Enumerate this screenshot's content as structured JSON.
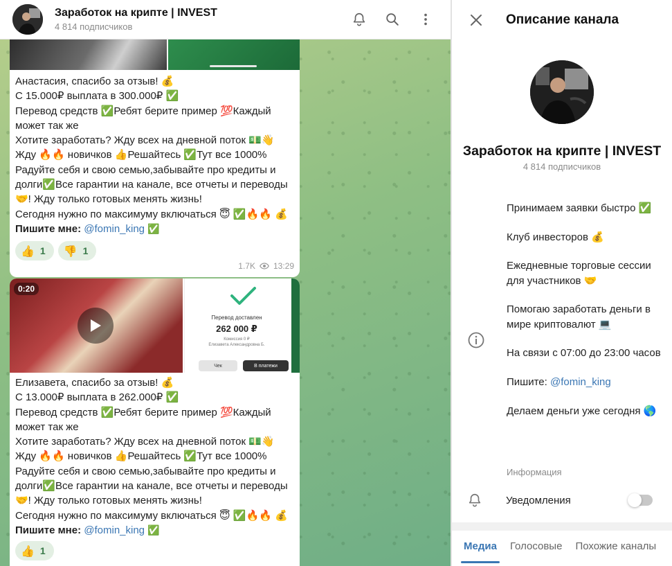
{
  "header": {
    "title": "Заработок на крипте | INVEST",
    "subscribers": "4 814 подписчиков",
    "icons": [
      "bell-icon",
      "search-icon",
      "more-vert-icon"
    ]
  },
  "messages": [
    {
      "text": "Анастасия, спасибо за отзыв! 💰\nС 15.000₽ выплата в 300.000₽ ✅\nПеревод средств ✅Ребят берите пример 💯Каждый может так же\nХотите заработать? Жду всех на дневной поток 💵👋\nЖду 🔥🔥 новичков 👍Решайтесь ✅Тут все 1000%\nРадуйте себя и свою семью,забывайте про кредиты и долги✅Все гарантии на канале, все отчеты и переводы🤝! Жду только готовых менять жизнь!\nСегодня нужно по максимуму включаться 😇 ✅🔥🔥 💰",
      "contact_prefix": "Пишите мне:",
      "contact_link": "@fomin_king",
      "contact_suffix": "✅",
      "reactions": [
        {
          "emoji": "👍",
          "count": "1"
        },
        {
          "emoji": "👎",
          "count": "1"
        }
      ],
      "views": "1.7K",
      "time": "13:29"
    },
    {
      "video_duration": "0:20",
      "receipt": {
        "title": "Перевод доставлен",
        "amount": "262 000 ₽",
        "details": "Комиссия 0 ₽\nЕлизавета Александровна Б.",
        "button_left": "Чек",
        "button_right": "В платежи"
      },
      "text": "Елизавета, спасибо за отзыв! 💰\nС 13.000₽ выплата в 262.000₽ ✅\nПеревод средств ✅Ребят берите пример 💯Каждый может так же\nХотите заработать? Жду всех на дневной поток 💵👋\nЖду 🔥🔥 новичков 👍Решайтесь ✅Тут все 1000%\nРадуйте себя и свою семью,забывайте про кредиты и долги✅Все гарантии на канале, все отчеты и переводы🤝! Жду только готовых менять жизнь!\nСегодня нужно по максимуму включаться 😇 ✅🔥🔥 💰",
      "contact_prefix": "Пишите мне:",
      "contact_link": "@fomin_king",
      "contact_suffix": "✅",
      "reactions": [
        {
          "emoji": "👍",
          "count": "1"
        }
      ]
    }
  ],
  "panel": {
    "title": "Описание канала",
    "channel_name": "Заработок на крипте | INVEST",
    "subscribers": "4 814 подписчиков",
    "description": [
      "Принимаем заявки быстро ✅",
      "Клуб инвесторов 💰",
      "Ежедневные торговые сессии для участников 🤝",
      "Помогаю заработать деньги в мире криптовалют 💻",
      "На связи с 07:00 до 23:00 часов"
    ],
    "write_prefix": "Пишите:",
    "write_link": "@fomin_king",
    "last_line": "Делаем деньги уже сегодня 🌎",
    "info_label": "Информация",
    "notifications_label": "Уведомления",
    "notifications_on": false,
    "tabs": [
      "Медиа",
      "Голосовые",
      "Похожие каналы"
    ],
    "active_tab": "Медиа"
  },
  "colors": {
    "accent": "#3a76b3",
    "reaction_bg": "#e3efe3",
    "chat_bg": "#8fbf84"
  }
}
